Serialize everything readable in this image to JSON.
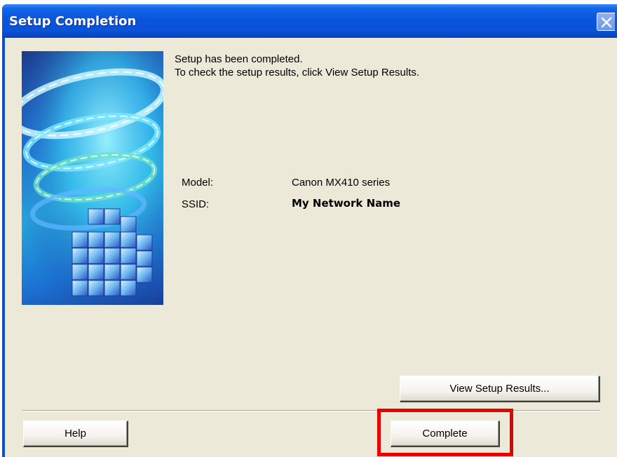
{
  "window": {
    "title": "Setup Completion"
  },
  "message": {
    "line1": "Setup has been completed.",
    "line2": "To check the setup results, click View Setup Results."
  },
  "details": {
    "model_label": "Model:",
    "model_value": "Canon MX410 series",
    "ssid_label": "SSID:",
    "ssid_value": "My Network Name"
  },
  "buttons": {
    "view_results": "View Setup Results...",
    "help": "Help",
    "complete": "Complete"
  },
  "colors": {
    "titlebar": "#0a52d6",
    "dialog_background": "#ece9d8",
    "highlight": "#e60000"
  },
  "icons": {
    "close": "close-icon",
    "side_image": "setup-illustration"
  }
}
